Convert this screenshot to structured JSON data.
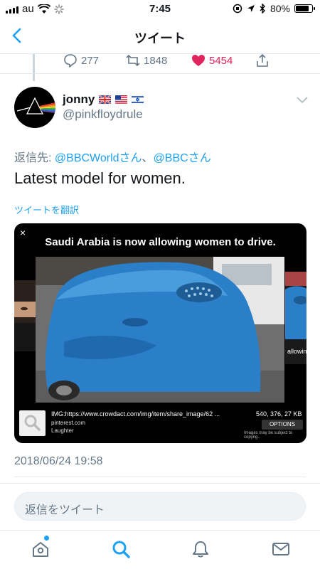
{
  "status_bar": {
    "carrier": "au",
    "time": "7:45",
    "battery_percent": "80%",
    "battery_level": 0.8
  },
  "nav": {
    "title": "ツイート"
  },
  "prev_tweet_actions": {
    "replies": "277",
    "retweets": "1848",
    "likes": "5454"
  },
  "tweet": {
    "display_name": "jonny",
    "username": "@pinkfloydrule",
    "reply_prefix": "返信先: ",
    "reply_target_1": "@BBCWorldさん",
    "reply_separator": "、",
    "reply_target_2": "@BBCさん",
    "text": "Latest model for women.",
    "translate_label": "ツイートを翻訳",
    "timestamp": "2018/06/24 19:58"
  },
  "media": {
    "close_label": "×",
    "caption": "Saudi Arabia is now allowing women to drive.",
    "side_label": "allowin",
    "source_url": "IMG:https://www.crowdact.com/img/item/share_image/62 ...",
    "source_site": "pinterest.com",
    "source_author": "Laughter",
    "dimensions": "540, 376, 27 KB",
    "options_label": "OPTIONS",
    "copyright": "Images may be subject to copyrig.."
  },
  "reply_bar": {
    "placeholder": "返信をツイート"
  },
  "colors": {
    "accent": "#1da1f2",
    "like": "#e0245e",
    "secondary_text": "#657786"
  },
  "icons": {
    "back": "chevron-left-icon",
    "reply": "reply-bubble-icon",
    "retweet": "retweet-icon",
    "like": "heart-icon",
    "share": "share-icon",
    "more": "chevron-down-icon",
    "home": "home-icon",
    "search": "search-icon",
    "notifications": "bell-icon",
    "messages": "mail-icon"
  }
}
